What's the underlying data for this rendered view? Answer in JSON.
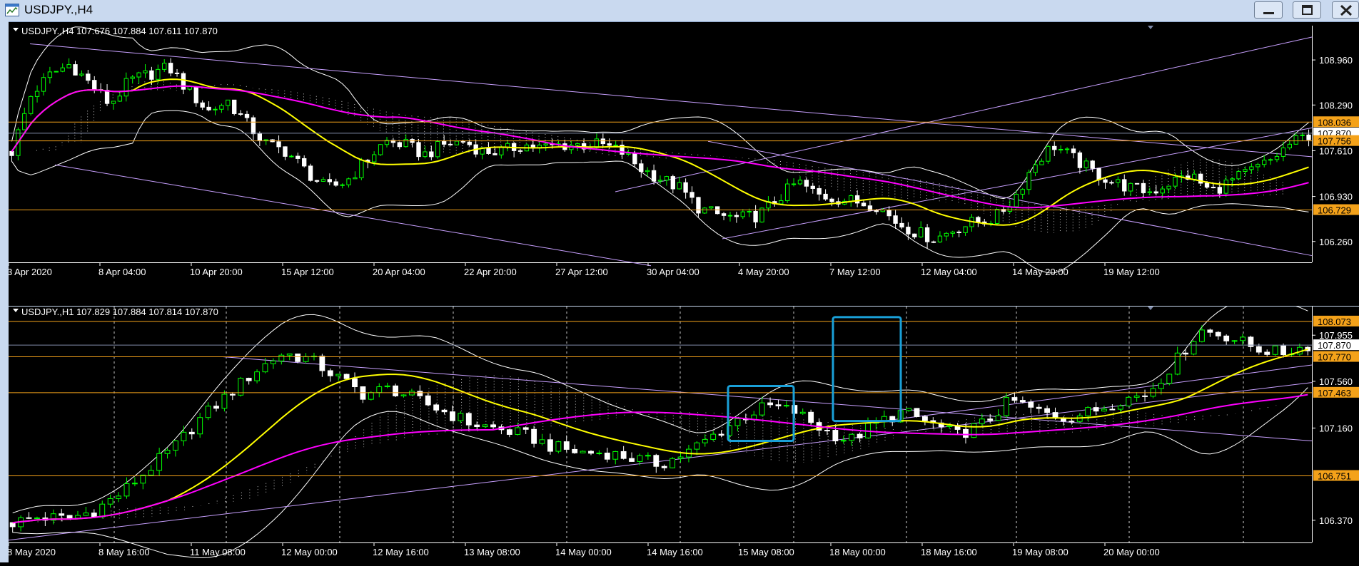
{
  "window": {
    "title": "USDJPY.,H4"
  },
  "colors": {
    "bg": "#000000",
    "bull": "#00ff00",
    "bear": "#ffffff",
    "ma_fast": "#ffff00",
    "ma_slow": "#ff00ff",
    "bands": "#ffffff",
    "trend": "#c8a0ff",
    "level": "#f4a21a",
    "current": "#7f8aa8",
    "highlight": "#1aa0d8",
    "axis_text": "#ffffff",
    "grid": "#ffffff"
  },
  "icons": {
    "app": "chart-window-icon",
    "minimize": "minimize-icon",
    "maximize": "maximize-icon",
    "close": "close-icon"
  },
  "panels": [
    {
      "id": "h4",
      "header": "USDJPY.,H4  107.676 107.884 107.611 107.870",
      "y_ticks": [
        "108.960",
        "108.290",
        "107.610",
        "106.930",
        "106.260"
      ],
      "x_ticks": [
        "3 Apr 2020",
        "8 Apr 04:00",
        "10 Apr 20:00",
        "15 Apr 12:00",
        "20 Apr 04:00",
        "22 Apr 20:00",
        "27 Apr 12:00",
        "30 Apr 04:00",
        "4 May 20:00",
        "7 May 12:00",
        "12 May 04:00",
        "14 May 20:00",
        "19 May 12:00"
      ],
      "price_labels": [
        "108.036",
        "107.870",
        "107.756",
        "106.729"
      ],
      "chart_data": {
        "type": "candlestick",
        "symbol": "USDJPY.",
        "timeframe": "H4",
        "ohlc_last": {
          "open": 107.676,
          "high": 107.884,
          "low": 107.611,
          "close": 107.87
        },
        "ylim": [
          105.95,
          109.47
        ],
        "y_ticks": [
          108.96,
          108.29,
          107.61,
          106.93,
          106.26
        ],
        "horizontal_levels": [
          108.036,
          107.756,
          106.729
        ],
        "current_price": 107.87,
        "close_path": [
          107.6,
          108.45,
          108.75,
          108.9,
          108.6,
          108.3,
          108.65,
          108.75,
          108.85,
          108.5,
          108.2,
          108.35,
          108.0,
          107.7,
          107.6,
          107.3,
          107.05,
          107.15,
          107.45,
          107.75,
          107.7,
          107.55,
          107.7,
          107.75,
          107.6,
          107.6,
          107.7,
          107.65,
          107.7,
          107.7,
          107.7,
          107.6,
          107.35,
          107.2,
          107.05,
          106.75,
          106.65,
          106.6,
          106.65,
          106.9,
          107.15,
          106.95,
          106.9,
          106.85,
          106.8,
          106.55,
          106.4,
          106.3,
          106.45,
          106.55,
          106.6,
          106.9,
          107.4,
          107.7,
          107.5,
          107.3,
          107.15,
          107.05,
          107.0,
          107.15,
          107.25,
          107.0,
          107.15,
          107.3,
          107.45,
          107.7,
          107.85
        ]
      }
    },
    {
      "id": "h1",
      "header": "USDJPY.,H1  107.829 107.884 107.814 107.870",
      "y_ticks": [
        "107.955",
        "107.560",
        "107.160",
        "106.370"
      ],
      "x_ticks": [
        "8 May 2020",
        "8 May 16:00",
        "11 May 08:00",
        "12 May 00:00",
        "12 May 16:00",
        "13 May 08:00",
        "14 May 00:00",
        "14 May 16:00",
        "15 May 08:00",
        "18 May 00:00",
        "18 May 16:00",
        "19 May 08:00",
        "20 May 00:00"
      ],
      "price_labels": [
        "108.073",
        "107.870",
        "107.770",
        "107.463",
        "106.751"
      ],
      "chart_data": {
        "type": "candlestick",
        "symbol": "USDJPY.",
        "timeframe": "H1",
        "ohlc_last": {
          "open": 107.829,
          "high": 107.884,
          "low": 107.814,
          "close": 107.87
        },
        "ylim": [
          106.18,
          108.17
        ],
        "y_ticks": [
          107.955,
          107.56,
          107.16,
          106.37
        ],
        "horizontal_levels": [
          108.073,
          107.77,
          107.463,
          106.751
        ],
        "current_price": 107.87,
        "close_path": [
          106.35,
          106.4,
          106.38,
          106.45,
          106.6,
          106.8,
          107.0,
          107.25,
          107.45,
          107.65,
          107.8,
          107.75,
          107.6,
          107.45,
          107.5,
          107.4,
          107.3,
          107.2,
          107.15,
          107.1,
          107.0,
          106.95,
          106.95,
          106.9,
          106.85,
          106.95,
          107.1,
          107.25,
          107.35,
          107.3,
          107.15,
          107.05,
          107.2,
          107.3,
          107.2,
          107.1,
          107.2,
          107.4,
          107.3,
          107.25,
          107.3,
          107.4,
          107.45,
          107.7,
          108.0,
          107.95,
          107.85,
          107.8,
          107.87
        ]
      }
    }
  ]
}
